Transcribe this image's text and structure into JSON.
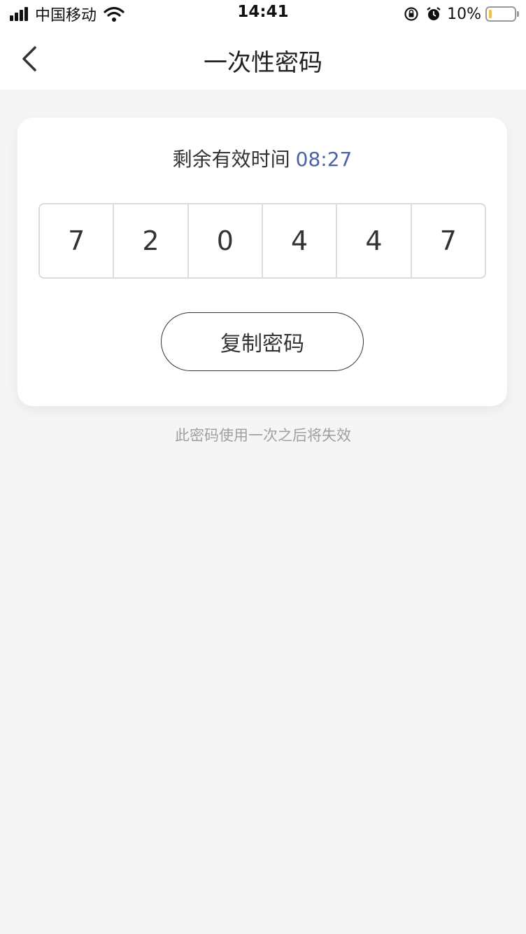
{
  "status_bar": {
    "carrier": "中国移动",
    "time": "14:41",
    "battery_percent": "10%",
    "battery_level": 0.1,
    "icons": [
      "signal-icon",
      "wifi-icon",
      "rotation-lock-icon",
      "alarm-icon",
      "battery-icon"
    ]
  },
  "nav": {
    "title": "一次性密码",
    "back_icon": "chevron-left-icon"
  },
  "card": {
    "timer_label": "剩余有效时间",
    "timer_value": "08:27",
    "code_digits": [
      "7",
      "2",
      "0",
      "4",
      "4",
      "7"
    ],
    "copy_button_label": "复制密码"
  },
  "note": "此密码使用一次之后将失效",
  "colors": {
    "accent": "#4a63a8",
    "background": "#f5f5f5",
    "card": "#ffffff",
    "battery_fill": "#f4c430"
  }
}
